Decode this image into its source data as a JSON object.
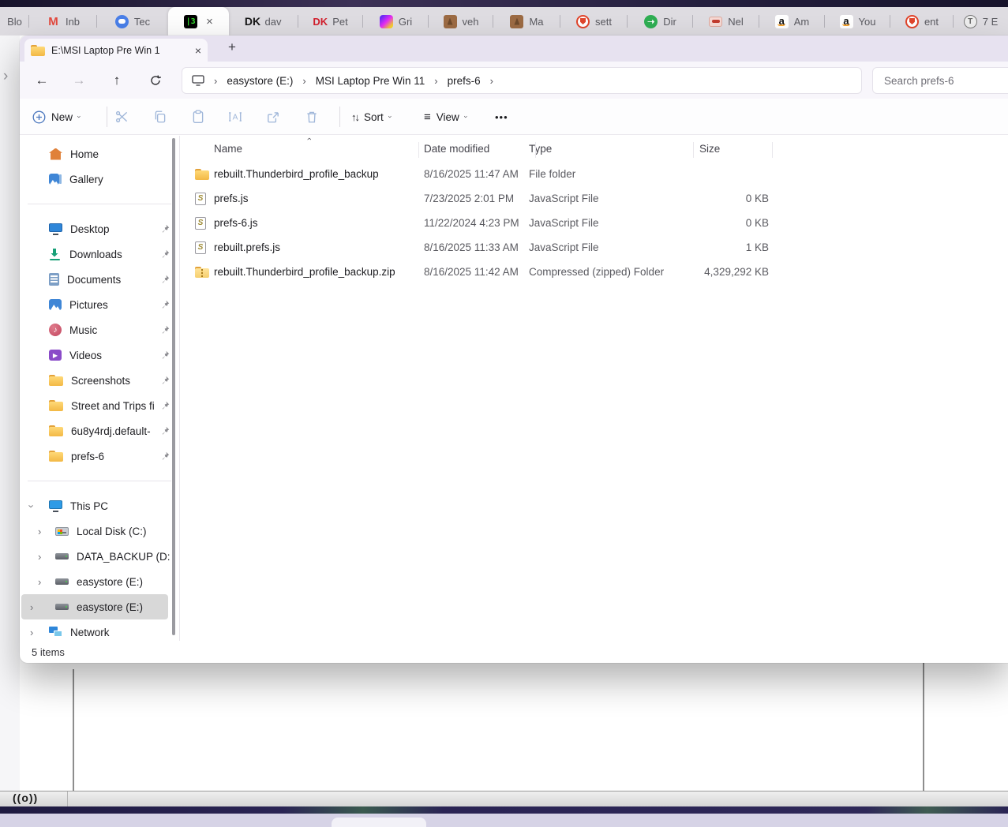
{
  "icons": {
    "back": "←",
    "forward": "→",
    "up": "↑",
    "chevron": "›",
    "close": "×",
    "plus_tab": "+",
    "more": "•••",
    "sort_glyph": "↑↓",
    "view_glyph": "≡",
    "note": "♪",
    "play": "▶",
    "terminal_glyph": "|3",
    "dk_black": "DK",
    "dk_red": "DK",
    "gmail_m": "M",
    "amazon_a": "a",
    "clock_t": "T",
    "dir_arrow": "➝",
    "left_panel_chevron": "›",
    "broadcast": "((o))",
    "js_glyph": "S"
  },
  "browser": {
    "tabs": [
      {
        "label": "Blo"
      },
      {
        "label": "Inb"
      },
      {
        "label": "Tec"
      },
      {
        "label": ""
      },
      {
        "label": "dav"
      },
      {
        "label": "Pet"
      },
      {
        "label": "Gri"
      },
      {
        "label": "veh"
      },
      {
        "label": "Ma"
      },
      {
        "label": "sett"
      },
      {
        "label": "Dir"
      },
      {
        "label": "Nel"
      },
      {
        "label": "Am"
      },
      {
        "label": "You"
      },
      {
        "label": "ent"
      },
      {
        "label": "7 E"
      }
    ]
  },
  "explorer": {
    "tab_title": "E:\\MSI Laptop Pre Win 1",
    "nav": {
      "breadcrumb": [
        "easystore (E:)",
        "MSI Laptop Pre Win 11",
        "prefs-6"
      ],
      "search_placeholder": "Search prefs-6"
    },
    "toolbar": {
      "new_label": "New",
      "sort_label": "Sort",
      "view_label": "View"
    },
    "sidebar": {
      "items": [
        {
          "label": "Home"
        },
        {
          "label": "Gallery"
        },
        {
          "label": "Desktop"
        },
        {
          "label": "Downloads"
        },
        {
          "label": "Documents"
        },
        {
          "label": "Pictures"
        },
        {
          "label": "Music"
        },
        {
          "label": "Videos"
        },
        {
          "label": "Screenshots"
        },
        {
          "label": "Street and Trips fi"
        },
        {
          "label": "6u8y4rdj.default-"
        },
        {
          "label": "prefs-6"
        },
        {
          "label": "This PC"
        },
        {
          "label": "Local Disk (C:)"
        },
        {
          "label": "DATA_BACKUP (D:"
        },
        {
          "label": "easystore (E:)"
        },
        {
          "label": "easystore (E:)"
        },
        {
          "label": "Network"
        }
      ]
    },
    "files": {
      "columns": {
        "name": "Name",
        "date": "Date modified",
        "type": "Type",
        "size": "Size"
      },
      "rows": [
        {
          "name": "rebuilt.Thunderbird_profile_backup",
          "date": "8/16/2025 11:47 AM",
          "type": "File folder",
          "size": ""
        },
        {
          "name": "prefs.js",
          "date": "7/23/2025 2:01 PM",
          "type": "JavaScript File",
          "size": "0 KB"
        },
        {
          "name": "prefs-6.js",
          "date": "11/22/2024 4:23 PM",
          "type": "JavaScript File",
          "size": "0 KB"
        },
        {
          "name": "rebuilt.prefs.js",
          "date": "8/16/2025 11:33 AM",
          "type": "JavaScript File",
          "size": "1 KB"
        },
        {
          "name": "rebuilt.Thunderbird_profile_backup.zip",
          "date": "8/16/2025 11:42 AM",
          "type": "Compressed (zipped) Folder",
          "size": "4,329,292 KB"
        }
      ]
    },
    "status": "5 items"
  },
  "colors": {
    "accent_blue": "#2e86d9",
    "folder_yellow": "#f3b845",
    "selection_gray": "#d8d8d8",
    "title_lavender": "#e7e2f0"
  }
}
